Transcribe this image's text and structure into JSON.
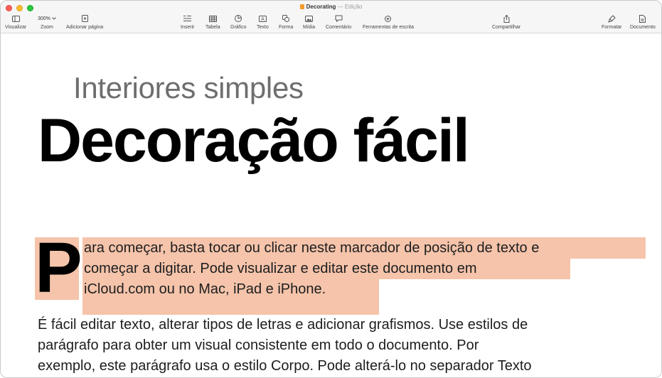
{
  "window": {
    "doc_name": "Decorating",
    "doc_status": "— Edição",
    "doc_icon": "pages-doc-icon"
  },
  "toolbar": {
    "left": [
      {
        "label": "Visualizar",
        "icon": "sidebar-icon"
      },
      {
        "label": "Zoom",
        "icon": "zoom-select",
        "value": "300%"
      },
      {
        "label": "Adicionar página",
        "icon": "add-page-icon"
      }
    ],
    "center": [
      {
        "label": "Inserir",
        "icon": "insert-icon"
      },
      {
        "label": "Tabela",
        "icon": "table-icon"
      },
      {
        "label": "Gráfico",
        "icon": "chart-icon"
      },
      {
        "label": "Texto",
        "icon": "text-box-icon"
      },
      {
        "label": "Forma",
        "icon": "shape-icon"
      },
      {
        "label": "Mídia",
        "icon": "media-icon"
      },
      {
        "label": "Comentário",
        "icon": "comment-icon"
      },
      {
        "label": "Ferramentas de escrita",
        "icon": "writing-tools-icon"
      }
    ],
    "share": {
      "label": "Compartilhar",
      "icon": "share-icon"
    },
    "right": [
      {
        "label": "Formatar",
        "icon": "format-brush-icon"
      },
      {
        "label": "Documento",
        "icon": "document-icon"
      }
    ]
  },
  "document": {
    "subtitle": "Interiores simples",
    "title": "Decoração fácil",
    "dropcap": "P",
    "para1": [
      "ara começar, basta tocar ou clicar neste marcador de posição de texto e",
      "começar a digitar. Pode visualizar e editar este documento em",
      "iCloud.com ou no Mac, iPad e iPhone."
    ],
    "para2": [
      "É fácil editar texto, alterar tipos de letras e adicionar grafismos. Use estilos de",
      "parágrafo para obter um visual consistente em todo o documento. Por",
      "exemplo, este parágrafo usa o estilo Corpo. Pode alterá-lo no separador Texto"
    ],
    "highlight_color": "#f5c4aa"
  }
}
